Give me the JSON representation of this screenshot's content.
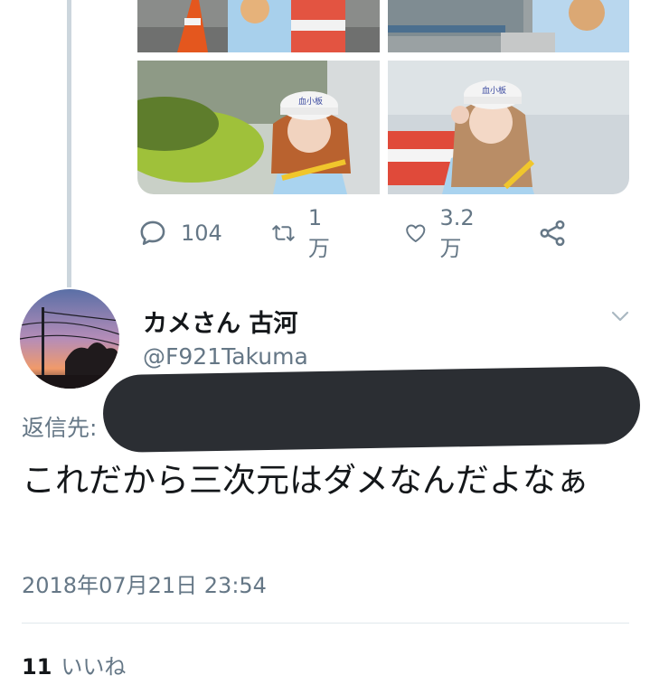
{
  "tweet_above": {
    "reply_count": "104",
    "retweet_count": "1万",
    "like_count": "3.2万",
    "cap_text": "血小板"
  },
  "reply": {
    "display_name": "カメさん 古河",
    "handle": "@F921Takuma",
    "reply_to_prefix": "返信先:",
    "text": "これだから三次元はダメなんだよなぁ",
    "timestamp": "2018年07月21日 23:54",
    "like_count": "11",
    "like_label": "いいね"
  },
  "colors": {
    "text_primary": "#14171a",
    "text_secondary": "#657786",
    "thread_line": "#ccd6dd",
    "divider": "#e1e8ed",
    "redaction": "#2b2e33"
  },
  "icons": [
    "reply-icon",
    "retweet-icon",
    "heart-icon",
    "share-icon",
    "chevron-down-icon"
  ]
}
